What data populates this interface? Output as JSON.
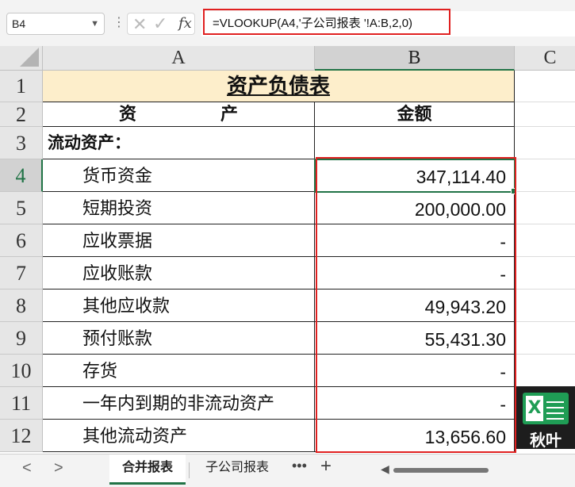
{
  "formula_bar": {
    "name_box": "B4",
    "formula": "=VLOOKUP(A4,'子公司报表 '!A:B,2,0)",
    "cancel_icon": "✕",
    "enter_icon": "✓",
    "fx_label": "fx"
  },
  "columns": [
    "A",
    "B",
    "C"
  ],
  "rows": [
    "1",
    "2",
    "3",
    "4",
    "5",
    "6",
    "7",
    "8",
    "9",
    "10",
    "11",
    "12"
  ],
  "sheet": {
    "title": "资产负债表",
    "header_asset_left": "资",
    "header_asset_right": "产",
    "header_amount": "金额",
    "section": "流动资产：",
    "items": [
      {
        "label": "货币资金",
        "value": "347,114.40"
      },
      {
        "label": "短期投资",
        "value": "200,000.00"
      },
      {
        "label": "应收票据",
        "value": "-"
      },
      {
        "label": "应收账款",
        "value": "-"
      },
      {
        "label": "其他应收款",
        "value": "49,943.20"
      },
      {
        "label": "预付账款",
        "value": "55,431.30"
      },
      {
        "label": "存货",
        "value": "-"
      },
      {
        "label": "一年内到期的非流动资产",
        "value": "-"
      },
      {
        "label": "其他流动资产",
        "value": "13,656.60"
      }
    ]
  },
  "watermark": {
    "icon": "excel-icon",
    "text": "秋叶"
  },
  "tabs": {
    "prev": "<",
    "next": ">",
    "items": [
      "合并报表",
      "子公司报表"
    ],
    "active": 0,
    "more": "•••",
    "add": "+"
  },
  "colors": {
    "accent": "#217346",
    "highlight": "#e02020",
    "title_fill": "#fdeecb"
  }
}
